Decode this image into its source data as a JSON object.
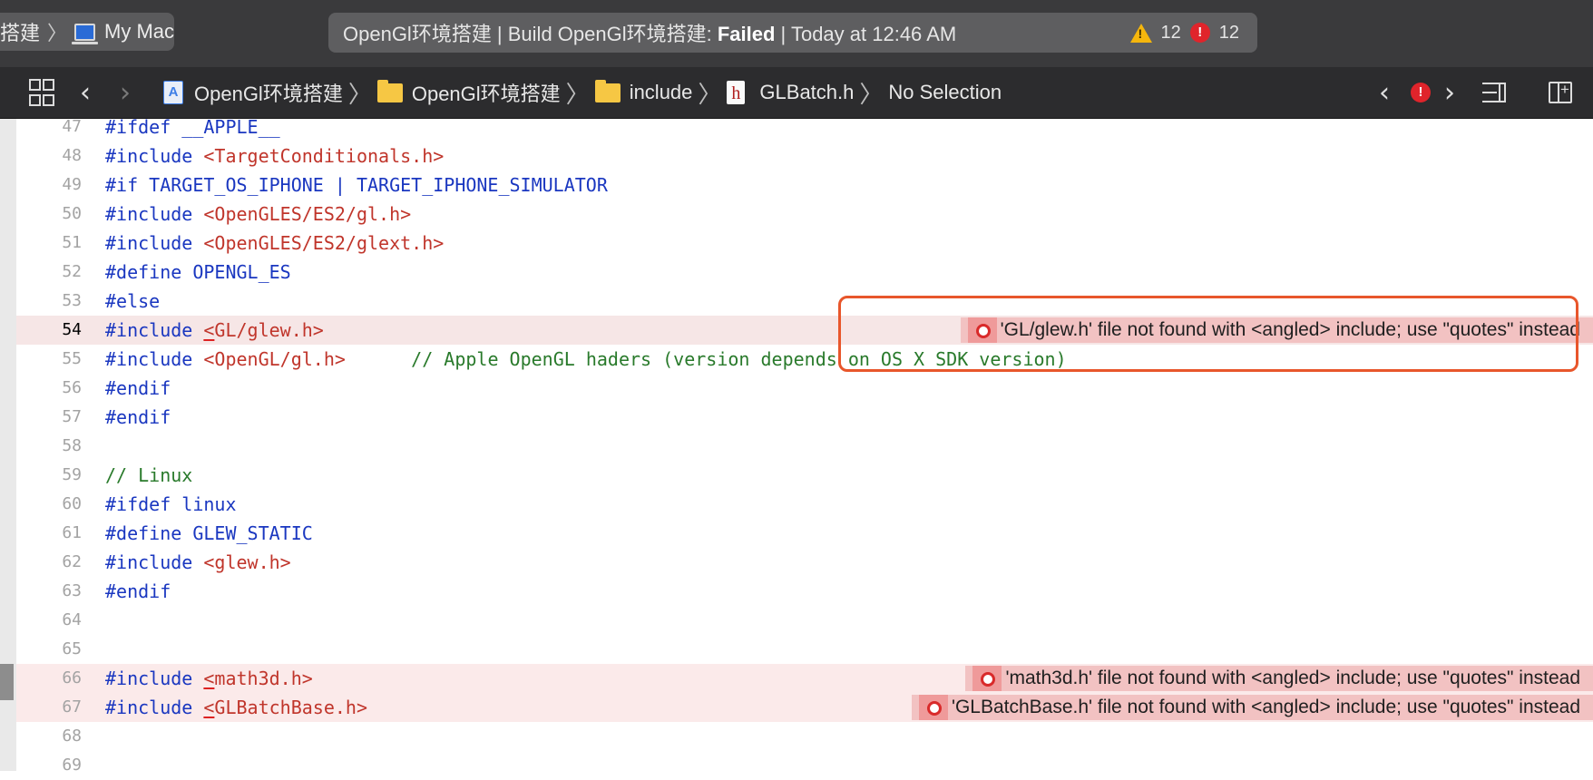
{
  "toolbar": {
    "scheme": {
      "target_partial": "搭建",
      "device": "My Mac"
    },
    "activity": {
      "prefix": "OpenGl环境搭建 | Build OpenGl环境搭建: ",
      "result": "Failed",
      "suffix": " | Today at 12:46 AM",
      "warning_count": "12",
      "error_count": "12"
    }
  },
  "jumpbar": {
    "crumbs": [
      "OpenGl环境搭建",
      "OpenGl环境搭建",
      "include",
      "GLBatch.h",
      "No Selection"
    ],
    "error_nav_glyph": "!"
  },
  "editor": {
    "lines": [
      {
        "n": "47",
        "text": "#ifdef __APPLE__"
      },
      {
        "n": "48",
        "text": "#include <TargetConditionals.h>"
      },
      {
        "n": "49",
        "text": "#if TARGET_OS_IPHONE | TARGET_IPHONE_SIMULATOR"
      },
      {
        "n": "50",
        "text": "#include <OpenGLES/ES2/gl.h>"
      },
      {
        "n": "51",
        "text": "#include <OpenGLES/ES2/glext.h>"
      },
      {
        "n": "52",
        "text": "#define OPENGL_ES"
      },
      {
        "n": "53",
        "text": "#else"
      },
      {
        "n": "54",
        "text": "#include <GL/glew.h>"
      },
      {
        "n": "55",
        "text": "#include <OpenGL/gl.h>      // Apple OpenGL haders (version depends on OS X SDK version)"
      },
      {
        "n": "56",
        "text": "#endif"
      },
      {
        "n": "57",
        "text": "#endif"
      },
      {
        "n": "58",
        "text": ""
      },
      {
        "n": "59",
        "text": "// Linux"
      },
      {
        "n": "60",
        "text": "#ifdef linux"
      },
      {
        "n": "61",
        "text": "#define GLEW_STATIC"
      },
      {
        "n": "62",
        "text": "#include <glew.h>"
      },
      {
        "n": "63",
        "text": "#endif"
      },
      {
        "n": "64",
        "text": ""
      },
      {
        "n": "65",
        "text": ""
      },
      {
        "n": "66",
        "text": "#include <math3d.h>"
      },
      {
        "n": "67",
        "text": "#include <GLBatchBase.h>"
      },
      {
        "n": "68",
        "text": ""
      },
      {
        "n": "69",
        "text": ""
      }
    ],
    "issues": [
      {
        "line": "54",
        "message": "'GL/glew.h' file not found with <angled> include; use \"quotes\" instead"
      },
      {
        "line": "66",
        "message": "'math3d.h' file not found with <angled> include; use \"quotes\" instead"
      },
      {
        "line": "67",
        "message": "'GLBatchBase.h' file not found with <angled> include; use \"quotes\" instead"
      }
    ]
  },
  "colors": {
    "keyword": "#1a37c0",
    "string": "#c0352b",
    "comment": "#297a2b",
    "error_line_bg": "#fbeaea",
    "annotation_bg": "#f2c2c2",
    "highlight_border": "#e8562b"
  }
}
